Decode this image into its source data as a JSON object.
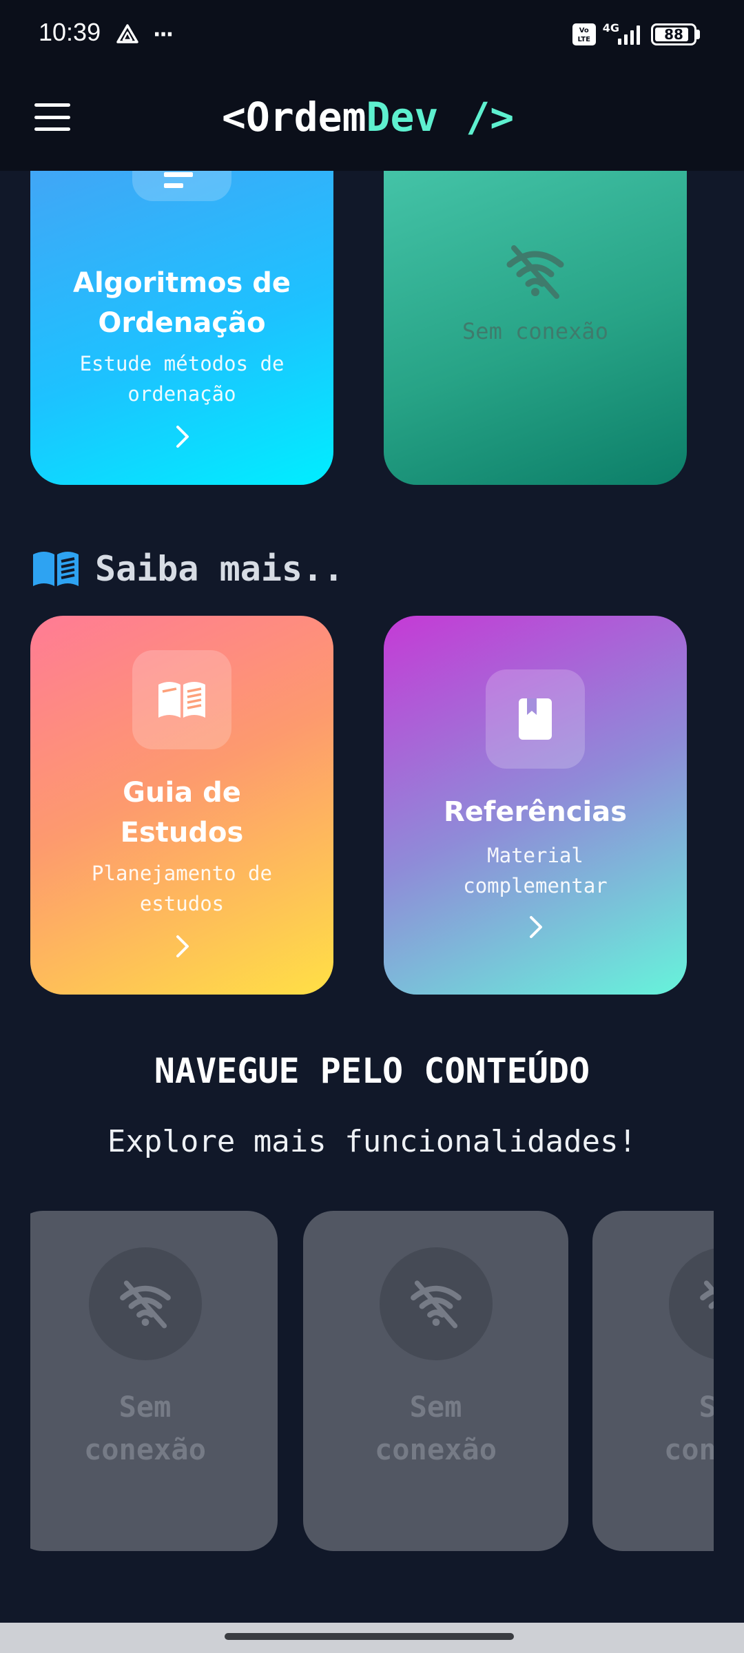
{
  "status_bar": {
    "time": "10:39",
    "more": "···",
    "volte": "Vo LTE",
    "network": "4G",
    "battery": "88"
  },
  "header": {
    "logo_open": "<",
    "logo_word1": "Ordem",
    "logo_word2": "Dev",
    "logo_close": "/>",
    "menu_icon": "hamburger-menu-icon"
  },
  "top_cards": {
    "algoritmos": {
      "title": "Algoritmos de Ordenação",
      "subtitle": "Estude métodos de ordenação",
      "icon": "sort-lines-icon"
    },
    "offline": {
      "text": "Sem conexão",
      "icon": "wifi-off-icon"
    }
  },
  "saiba_mais": {
    "heading": "Saiba mais..",
    "icon": "open-book-icon",
    "cards": [
      {
        "title": "Guia de Estudos",
        "subtitle": "Planejamento de estudos",
        "icon": "open-book-icon"
      },
      {
        "title": "Referências",
        "subtitle": "Material complementar",
        "icon": "bookmark-book-icon"
      }
    ]
  },
  "navegue": {
    "title": "NAVEGUE PELO CONTEÚDO",
    "subtitle": "Explore mais funcionalidades!",
    "cards": [
      {
        "text": "Sem conexão",
        "icon": "wifi-off-icon"
      },
      {
        "text": "Sem conexão",
        "icon": "wifi-off-icon"
      },
      {
        "text": "Sem conexão",
        "icon": "wifi-off-icon"
      }
    ]
  },
  "colors": {
    "background": "#111829",
    "header": "#0b0f1a",
    "logo_accent": "#5ef0cf",
    "section_icon": "#2ea3f2"
  }
}
